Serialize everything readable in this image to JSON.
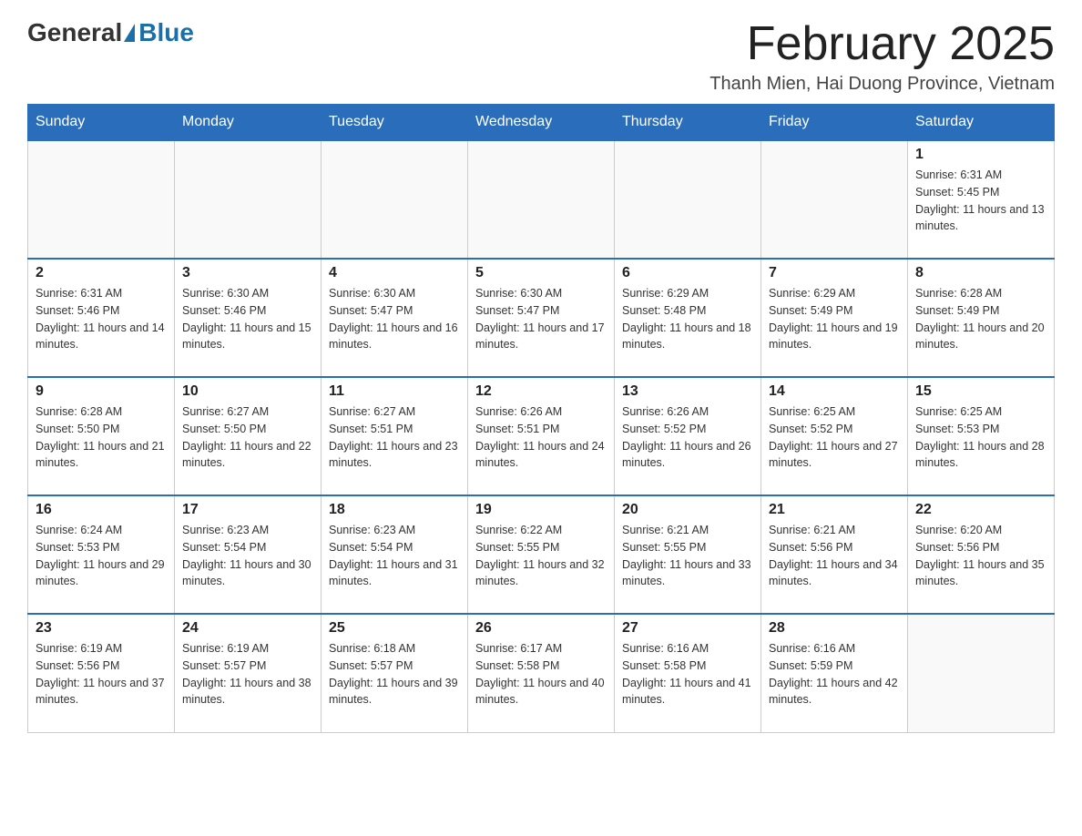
{
  "logo": {
    "general": "General",
    "blue": "Blue"
  },
  "header": {
    "title": "February 2025",
    "subtitle": "Thanh Mien, Hai Duong Province, Vietnam"
  },
  "weekdays": [
    "Sunday",
    "Monday",
    "Tuesday",
    "Wednesday",
    "Thursday",
    "Friday",
    "Saturday"
  ],
  "weeks": [
    [
      {
        "day": "",
        "info": ""
      },
      {
        "day": "",
        "info": ""
      },
      {
        "day": "",
        "info": ""
      },
      {
        "day": "",
        "info": ""
      },
      {
        "day": "",
        "info": ""
      },
      {
        "day": "",
        "info": ""
      },
      {
        "day": "1",
        "info": "Sunrise: 6:31 AM\nSunset: 5:45 PM\nDaylight: 11 hours and 13 minutes."
      }
    ],
    [
      {
        "day": "2",
        "info": "Sunrise: 6:31 AM\nSunset: 5:46 PM\nDaylight: 11 hours and 14 minutes."
      },
      {
        "day": "3",
        "info": "Sunrise: 6:30 AM\nSunset: 5:46 PM\nDaylight: 11 hours and 15 minutes."
      },
      {
        "day": "4",
        "info": "Sunrise: 6:30 AM\nSunset: 5:47 PM\nDaylight: 11 hours and 16 minutes."
      },
      {
        "day": "5",
        "info": "Sunrise: 6:30 AM\nSunset: 5:47 PM\nDaylight: 11 hours and 17 minutes."
      },
      {
        "day": "6",
        "info": "Sunrise: 6:29 AM\nSunset: 5:48 PM\nDaylight: 11 hours and 18 minutes."
      },
      {
        "day": "7",
        "info": "Sunrise: 6:29 AM\nSunset: 5:49 PM\nDaylight: 11 hours and 19 minutes."
      },
      {
        "day": "8",
        "info": "Sunrise: 6:28 AM\nSunset: 5:49 PM\nDaylight: 11 hours and 20 minutes."
      }
    ],
    [
      {
        "day": "9",
        "info": "Sunrise: 6:28 AM\nSunset: 5:50 PM\nDaylight: 11 hours and 21 minutes."
      },
      {
        "day": "10",
        "info": "Sunrise: 6:27 AM\nSunset: 5:50 PM\nDaylight: 11 hours and 22 minutes."
      },
      {
        "day": "11",
        "info": "Sunrise: 6:27 AM\nSunset: 5:51 PM\nDaylight: 11 hours and 23 minutes."
      },
      {
        "day": "12",
        "info": "Sunrise: 6:26 AM\nSunset: 5:51 PM\nDaylight: 11 hours and 24 minutes."
      },
      {
        "day": "13",
        "info": "Sunrise: 6:26 AM\nSunset: 5:52 PM\nDaylight: 11 hours and 26 minutes."
      },
      {
        "day": "14",
        "info": "Sunrise: 6:25 AM\nSunset: 5:52 PM\nDaylight: 11 hours and 27 minutes."
      },
      {
        "day": "15",
        "info": "Sunrise: 6:25 AM\nSunset: 5:53 PM\nDaylight: 11 hours and 28 minutes."
      }
    ],
    [
      {
        "day": "16",
        "info": "Sunrise: 6:24 AM\nSunset: 5:53 PM\nDaylight: 11 hours and 29 minutes."
      },
      {
        "day": "17",
        "info": "Sunrise: 6:23 AM\nSunset: 5:54 PM\nDaylight: 11 hours and 30 minutes."
      },
      {
        "day": "18",
        "info": "Sunrise: 6:23 AM\nSunset: 5:54 PM\nDaylight: 11 hours and 31 minutes."
      },
      {
        "day": "19",
        "info": "Sunrise: 6:22 AM\nSunset: 5:55 PM\nDaylight: 11 hours and 32 minutes."
      },
      {
        "day": "20",
        "info": "Sunrise: 6:21 AM\nSunset: 5:55 PM\nDaylight: 11 hours and 33 minutes."
      },
      {
        "day": "21",
        "info": "Sunrise: 6:21 AM\nSunset: 5:56 PM\nDaylight: 11 hours and 34 minutes."
      },
      {
        "day": "22",
        "info": "Sunrise: 6:20 AM\nSunset: 5:56 PM\nDaylight: 11 hours and 35 minutes."
      }
    ],
    [
      {
        "day": "23",
        "info": "Sunrise: 6:19 AM\nSunset: 5:56 PM\nDaylight: 11 hours and 37 minutes."
      },
      {
        "day": "24",
        "info": "Sunrise: 6:19 AM\nSunset: 5:57 PM\nDaylight: 11 hours and 38 minutes."
      },
      {
        "day": "25",
        "info": "Sunrise: 6:18 AM\nSunset: 5:57 PM\nDaylight: 11 hours and 39 minutes."
      },
      {
        "day": "26",
        "info": "Sunrise: 6:17 AM\nSunset: 5:58 PM\nDaylight: 11 hours and 40 minutes."
      },
      {
        "day": "27",
        "info": "Sunrise: 6:16 AM\nSunset: 5:58 PM\nDaylight: 11 hours and 41 minutes."
      },
      {
        "day": "28",
        "info": "Sunrise: 6:16 AM\nSunset: 5:59 PM\nDaylight: 11 hours and 42 minutes."
      },
      {
        "day": "",
        "info": ""
      }
    ]
  ]
}
